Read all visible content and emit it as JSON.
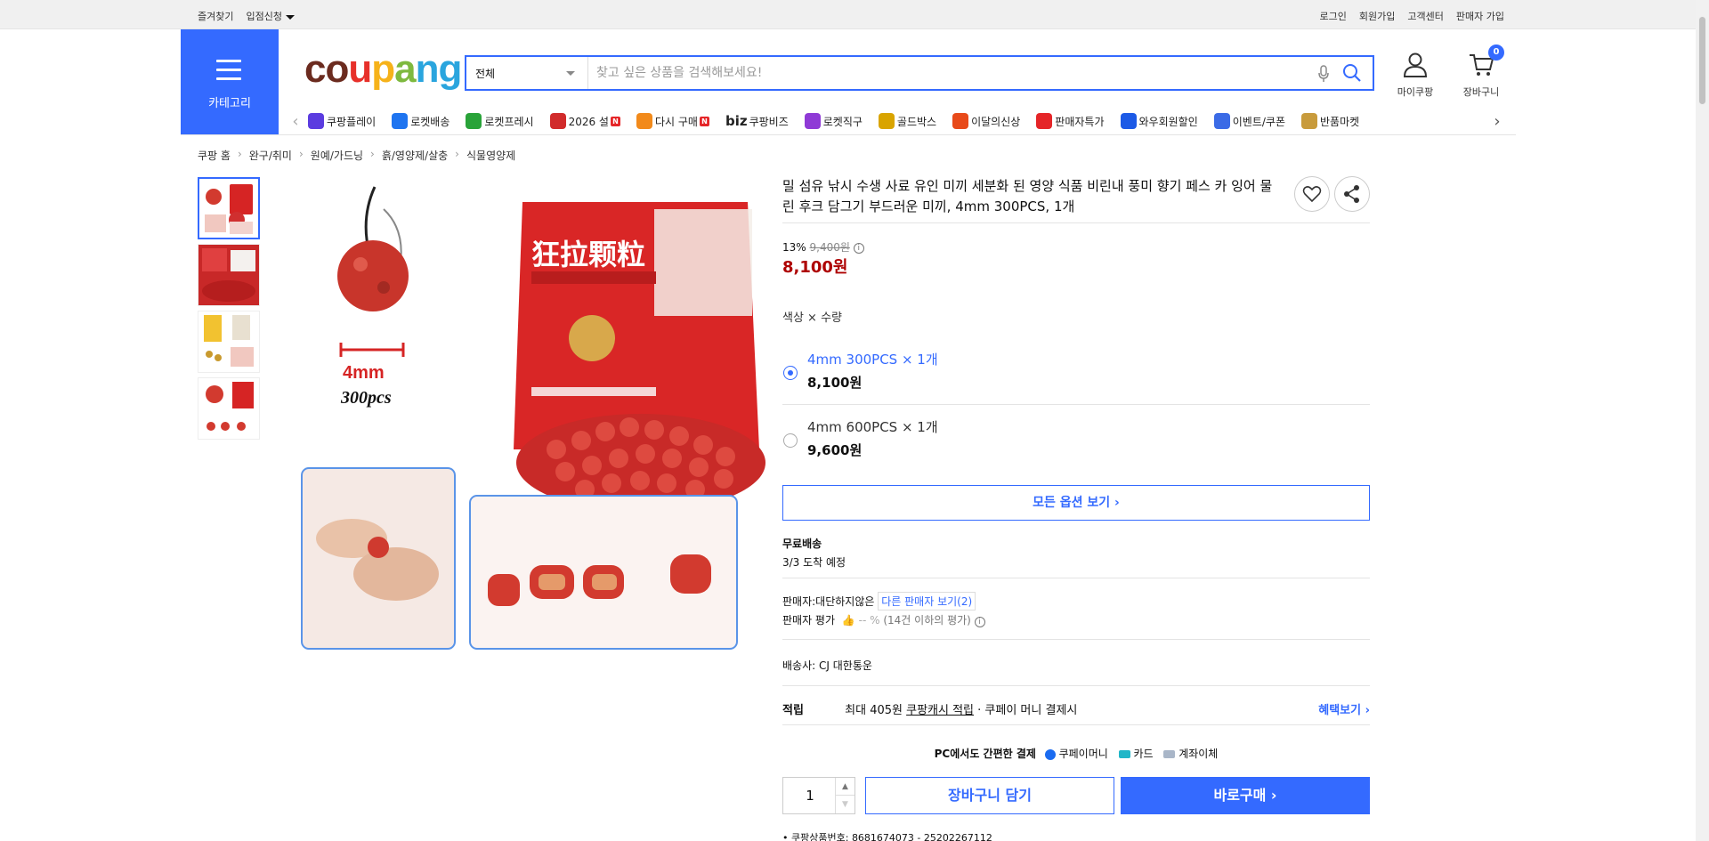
{
  "topbar": {
    "favorites": "즐겨찾기",
    "partner_apply": "입점신청",
    "login": "로그인",
    "signup": "회원가입",
    "customer_center": "고객센터",
    "seller_signup": "판매자 가입"
  },
  "header": {
    "category_label": "카테고리",
    "logo_text": "coupang",
    "search_scope": "전체",
    "search_placeholder": "찾고 싶은 상품을 검색해보세요!",
    "my_coupang": "마이쿠팡",
    "cart_label": "장바구니",
    "cart_count": "0"
  },
  "nav": {
    "items": [
      {
        "label": "쿠팡플레이",
        "icon": "coupang-play-icon",
        "color": "#5b3ce0"
      },
      {
        "label": "로켓배송",
        "icon": "rocket-icon",
        "color": "#1e74f0"
      },
      {
        "label": "로켓프레시",
        "icon": "rocket-fresh-icon",
        "color": "#29a339"
      },
      {
        "label": "2026 설",
        "icon": "new-year-icon",
        "color": "#d12b2b",
        "badge": "N"
      },
      {
        "label": "다시 구매",
        "icon": "repurchase-icon",
        "color": "#f28a1b",
        "badge": "N"
      },
      {
        "label": "쿠팡비즈",
        "prefix": "biz",
        "icon": "biz-icon",
        "color": "#333333"
      },
      {
        "label": "로켓직구",
        "icon": "rocket-global-icon",
        "color": "#8f3ad6"
      },
      {
        "label": "골드박스",
        "icon": "gold-box-icon",
        "color": "#d9a400"
      },
      {
        "label": "이달의신상",
        "icon": "new-arrivals-icon",
        "color": "#e84a1a"
      },
      {
        "label": "판매자특가",
        "icon": "seller-deal-icon",
        "color": "#e52528"
      },
      {
        "label": "와우회원할인",
        "icon": "wow-icon",
        "color": "#1c5ae6"
      },
      {
        "label": "이벤트/쿠폰",
        "icon": "event-coupon-icon",
        "color": "#3b6be6"
      },
      {
        "label": "반품마켓",
        "icon": "return-market-icon",
        "color": "#c89b3c"
      }
    ]
  },
  "breadcrumb": [
    "쿠팡 홈",
    "완구/취미",
    "원예/가드닝",
    "흙/영양제/살충",
    "식물영양제"
  ],
  "gallery": {
    "main_labels": {
      "size": "4mm",
      "count": "300pcs",
      "package_text": "狂拉颗粒"
    }
  },
  "product": {
    "title": "밀 섬유 낚시 수생 사료 유인 미끼 세분화 된 영양 식품 비린내 풍미 향기 페스 카 잉어 물린 후크 담그기 부드러운 미끼, 4mm 300PCS, 1개",
    "discount_rate": "13%",
    "original_price": "9,400원",
    "price": "8,100원",
    "option_label": "색상 × 수량",
    "options": [
      {
        "name": "4mm 300PCS × 1개",
        "price": "8,100원",
        "selected": true
      },
      {
        "name": "4mm 600PCS × 1개",
        "price": "9,600원",
        "selected": false
      }
    ],
    "all_options_label": "모든 옵션 보기 ›",
    "shipping_title": "무료배송",
    "arrival": "3/3 도착 예정",
    "seller_label": "판매자:",
    "seller_name": "대단하지않은",
    "other_sellers": "다른 판매자 보기(2)",
    "seller_rating_label": "판매자 평가",
    "seller_rating_value": "-- %",
    "seller_rating_note": "(14건 이하의 평가)",
    "carrier_label": "배송사:",
    "carrier": "CJ 대한통운",
    "reward_title": "적립",
    "reward_text": "최대 405원",
    "reward_link": "쿠팡캐시 적립",
    "reward_suffix": "· 쿠페이 머니 결제시",
    "benefits_link": "혜택보기 ›",
    "pay_title": "PC에서도 간편한 결제",
    "pay_methods": [
      "쿠페이머니",
      "카드",
      "계좌이체"
    ],
    "quantity": "1",
    "add_to_cart": "장바구니 담기",
    "buy_now": "바로구매 ›",
    "product_code_label": "쿠팡상품번호:",
    "product_code": "8681674073 - 25202267112"
  },
  "colors": {
    "accent": "#346aff",
    "price": "#ae0000"
  }
}
